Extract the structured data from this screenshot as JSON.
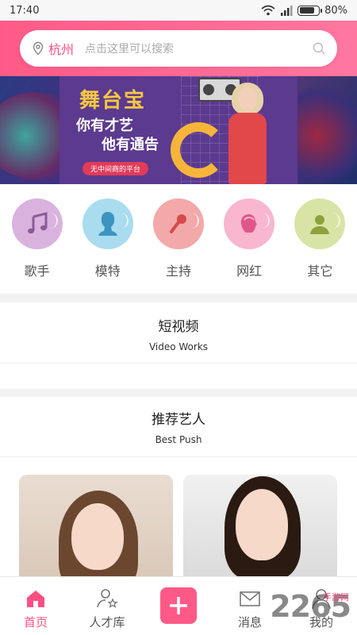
{
  "status_bar": {
    "time": "17:40",
    "battery": "80%",
    "battery_level": 0.8
  },
  "search": {
    "city": "杭州",
    "placeholder": "点击这里可以搜索"
  },
  "banner": {
    "brand": "舞台宝",
    "line1": "你有才艺",
    "line2": "他有通告",
    "tag": "无中间商的平台"
  },
  "categories": [
    {
      "label": "歌手",
      "icon": "music-note-icon",
      "color": "#d9b3de"
    },
    {
      "label": "模特",
      "icon": "model-silhouette-icon",
      "color": "#a9dcef"
    },
    {
      "label": "主持",
      "icon": "microphone-icon",
      "color": "#f3a9a9"
    },
    {
      "label": "网红",
      "icon": "female-head-icon",
      "color": "#f9b6cf"
    },
    {
      "label": "其它",
      "icon": "person-icon",
      "color": "#d8e4a6"
    }
  ],
  "video_section": {
    "title": "短视频",
    "subtitle": "Video Works"
  },
  "push_section": {
    "title": "推荐艺人",
    "subtitle": "Best Push"
  },
  "nav": {
    "home": "首页",
    "talent": "人才库",
    "messages": "消息",
    "mine": "我的"
  },
  "watermark": {
    "number": "2265",
    "text": "手游网"
  },
  "colors": {
    "accent": "#ff4f82",
    "header_start": "#ff5a87",
    "header_end": "#ff77a0"
  }
}
